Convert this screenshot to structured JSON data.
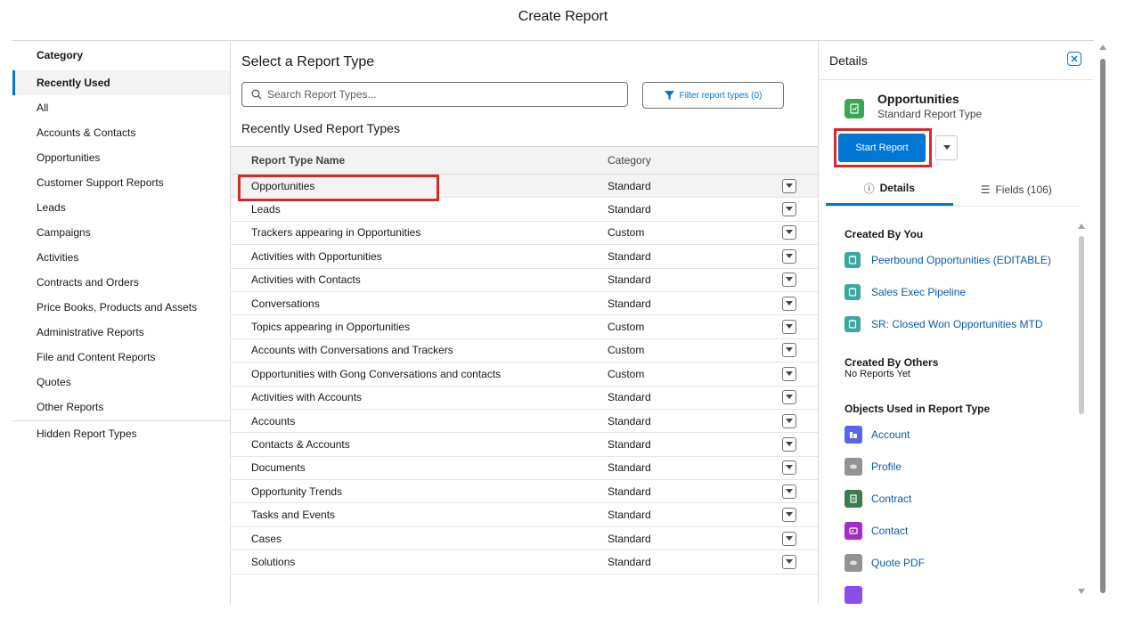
{
  "modal": {
    "title": "Create Report"
  },
  "categories": {
    "header": "Category",
    "items": [
      {
        "label": "Recently Used",
        "active": true
      },
      {
        "label": "All"
      },
      {
        "label": "Accounts & Contacts"
      },
      {
        "label": "Opportunities"
      },
      {
        "label": "Customer Support Reports"
      },
      {
        "label": "Leads"
      },
      {
        "label": "Campaigns"
      },
      {
        "label": "Activities"
      },
      {
        "label": "Contracts and Orders"
      },
      {
        "label": "Price Books, Products and Assets"
      },
      {
        "label": "Administrative Reports"
      },
      {
        "label": "File and Content Reports"
      },
      {
        "label": "Quotes"
      },
      {
        "label": "Other Reports"
      }
    ],
    "hidden_label": "Hidden Report Types"
  },
  "main": {
    "title": "Select a Report Type",
    "search_placeholder": "Search Report Types...",
    "filter_label": "Filter report types (0)",
    "section_title": "Recently Used Report Types",
    "columns": [
      "Report Type Name",
      "Category"
    ],
    "rows": [
      {
        "name": "Opportunities",
        "category": "Standard"
      },
      {
        "name": "Leads",
        "category": "Standard"
      },
      {
        "name": "Trackers appearing in Opportunities",
        "category": "Custom"
      },
      {
        "name": "Activities with Opportunities",
        "category": "Standard"
      },
      {
        "name": "Activities with Contacts",
        "category": "Standard"
      },
      {
        "name": "Conversations",
        "category": "Standard"
      },
      {
        "name": "Topics appearing in Opportunities",
        "category": "Custom"
      },
      {
        "name": "Accounts with Conversations and Trackers",
        "category": "Custom"
      },
      {
        "name": "Opportunities with Gong Conversations and contacts",
        "category": "Custom"
      },
      {
        "name": "Activities with Accounts",
        "category": "Standard"
      },
      {
        "name": "Accounts",
        "category": "Standard"
      },
      {
        "name": "Contacts & Accounts",
        "category": "Standard"
      },
      {
        "name": "Documents",
        "category": "Standard"
      },
      {
        "name": "Opportunity Trends",
        "category": "Standard"
      },
      {
        "name": "Tasks and Events",
        "category": "Standard"
      },
      {
        "name": "Cases",
        "category": "Standard"
      },
      {
        "name": "Solutions",
        "category": "Standard"
      }
    ]
  },
  "details": {
    "header": "Details",
    "report_type_name": "Opportunities",
    "report_type_sub": "Standard Report Type",
    "start_label": "Start Report",
    "tab_details": "Details",
    "tab_fields": "Fields (106)",
    "created_by_you_title": "Created By You",
    "created_by_you": [
      "Peerbound Opportunities (EDITABLE)",
      "Sales Exec Pipeline",
      "SR: Closed Won Opportunities MTD"
    ],
    "created_by_others_title": "Created By Others",
    "created_by_others_text": "No Reports Yet",
    "objects_title": "Objects Used in Report Type",
    "objects": [
      {
        "label": "Account",
        "icon": "account-icon",
        "color": "#5867e8"
      },
      {
        "label": "Profile",
        "icon": "profile-icon",
        "color": "#939393"
      },
      {
        "label": "Contract",
        "icon": "contract-icon",
        "color": "#3c7a52"
      },
      {
        "label": "Contact",
        "icon": "contact-icon",
        "color": "#a32dc7"
      },
      {
        "label": "Quote PDF",
        "icon": "quote-pdf-icon",
        "color": "#939393"
      }
    ]
  },
  "colors": {
    "accent": "#0176d3",
    "highlight": "#d62a2a",
    "report_icon": "#3ba755"
  }
}
